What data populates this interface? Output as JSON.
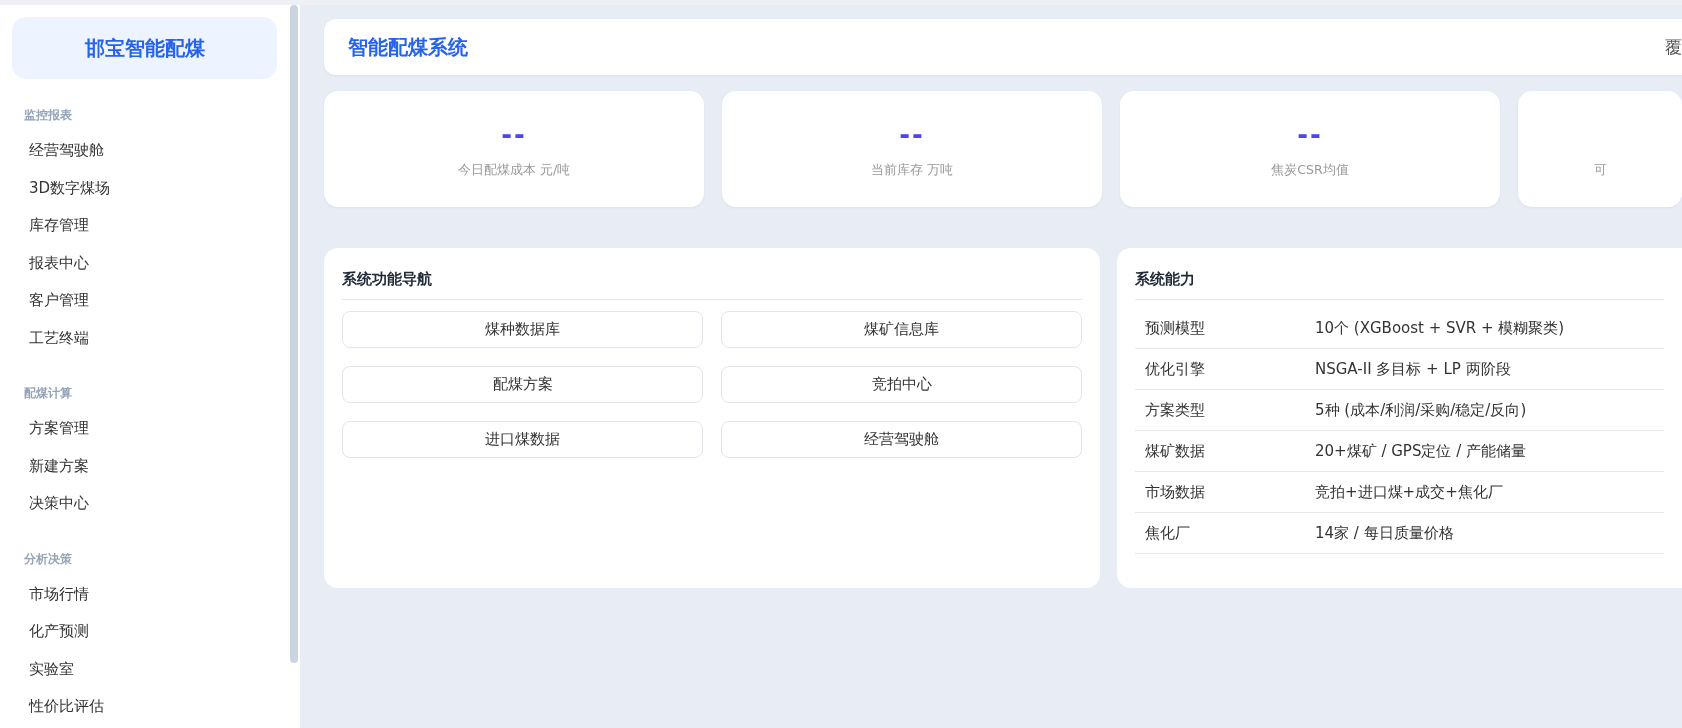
{
  "sidebar": {
    "brand": "邯宝智能配煤",
    "sections": [
      {
        "title": "监控报表",
        "items": [
          {
            "label": "经营驾驶舱"
          },
          {
            "label": "3D数字煤场"
          },
          {
            "label": "库存管理"
          },
          {
            "label": "报表中心"
          },
          {
            "label": "客户管理"
          },
          {
            "label": "工艺终端"
          }
        ]
      },
      {
        "title": "配煤计算",
        "items": [
          {
            "label": "方案管理"
          },
          {
            "label": "新建方案"
          },
          {
            "label": "决策中心"
          }
        ]
      },
      {
        "title": "分析决策",
        "items": [
          {
            "label": "市场行情"
          },
          {
            "label": "化产预测"
          },
          {
            "label": "实验室"
          },
          {
            "label": "性价比评估"
          }
        ]
      }
    ]
  },
  "header": {
    "title": "智能配煤系统",
    "right_text": "覆"
  },
  "stats": [
    {
      "value": "--",
      "label": "今日配煤成本 元/吨"
    },
    {
      "value": "--",
      "label": "当前库存 万吨"
    },
    {
      "value": "--",
      "label": "焦炭CSR均值"
    },
    {
      "label": "可"
    }
  ],
  "nav_panel": {
    "title": "系统功能导航",
    "buttons": [
      "煤种数据库",
      "煤矿信息库",
      "配煤方案",
      "竞拍中心",
      "进口煤数据",
      "经营驾驶舱"
    ]
  },
  "capability_panel": {
    "title": "系统能力",
    "rows": [
      {
        "name": "预测模型",
        "value": "10个 (XGBoost + SVR + 模糊聚类)"
      },
      {
        "name": "优化引擎",
        "value": "NSGA-II 多目标 + LP 两阶段"
      },
      {
        "name": "方案类型",
        "value": "5种 (成本/利润/采购/稳定/反向)"
      },
      {
        "name": "煤矿数据",
        "value": "20+煤矿 / GPS定位 / 产能储量"
      },
      {
        "name": "市场数据",
        "value": "竞拍+进口煤+成交+焦化厂"
      },
      {
        "name": "焦化厂",
        "value": "14家 / 每日质量价格"
      }
    ]
  }
}
